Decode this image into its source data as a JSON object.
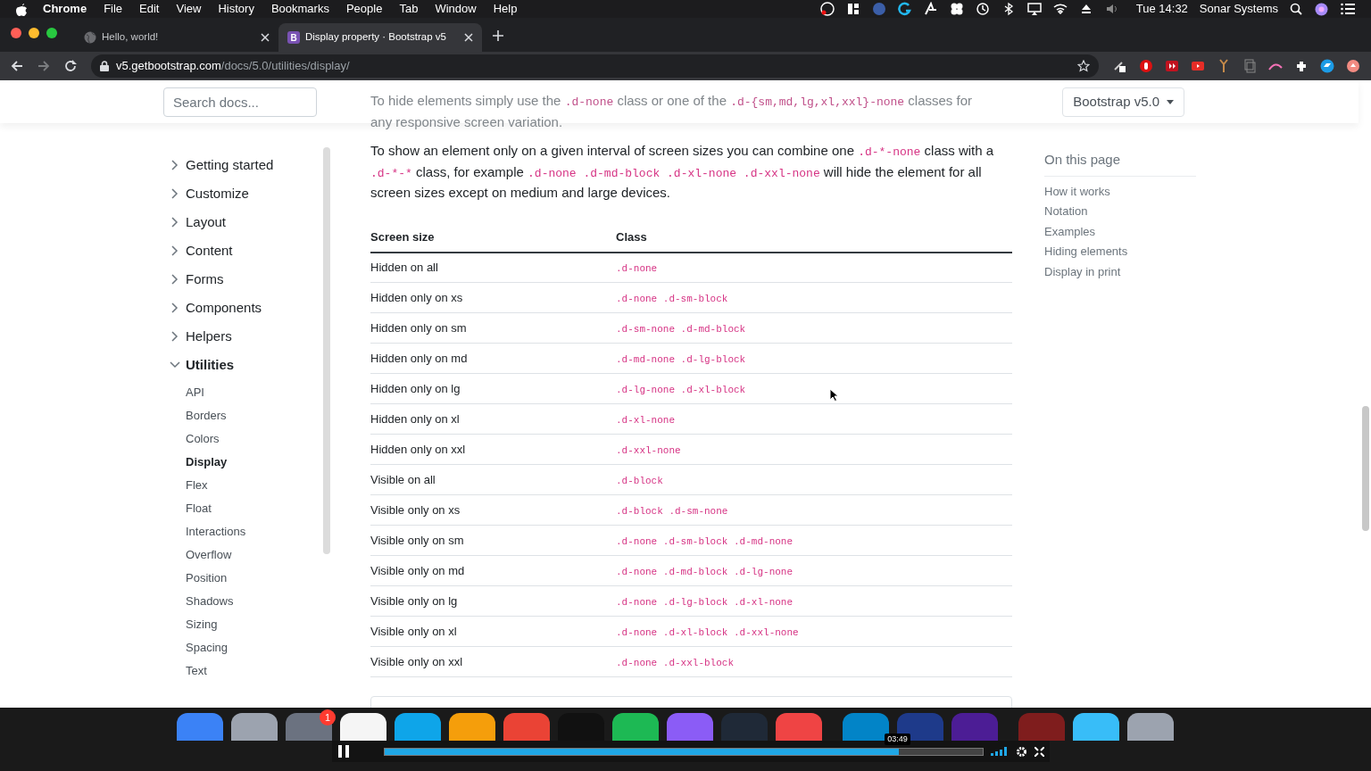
{
  "menubar": {
    "app": "Chrome",
    "menus": [
      "File",
      "Edit",
      "View",
      "History",
      "Bookmarks",
      "People",
      "Tab",
      "Window",
      "Help"
    ],
    "clock": "Tue 14:32",
    "user": "Sonar Systems"
  },
  "tabs": [
    {
      "title": "Hello, world!",
      "selected": false
    },
    {
      "title": "Display property · Bootstrap v5",
      "selected": true,
      "favicon_letter": "B"
    }
  ],
  "address": {
    "host": "v5.getbootstrap.com",
    "path": "/docs/5.0/utilities/display/"
  },
  "header": {
    "search_placeholder": "Search docs...",
    "version_button": "Bootstrap v5.0"
  },
  "faded_intro": [
    {
      "kind": "text",
      "text": "To hide elements simply use the "
    },
    {
      "kind": "code",
      "text": ".d-none"
    },
    {
      "kind": "text",
      "text": " class or one of the "
    },
    {
      "kind": "code",
      "text": ".d-{sm,md,lg,xl,xxl}-none"
    },
    {
      "kind": "text",
      "text": " classes for any responsive screen variation."
    }
  ],
  "sidebar": [
    {
      "label": "Getting started",
      "expanded": false
    },
    {
      "label": "Customize",
      "expanded": false
    },
    {
      "label": "Layout",
      "expanded": false
    },
    {
      "label": "Content",
      "expanded": false
    },
    {
      "label": "Forms",
      "expanded": false
    },
    {
      "label": "Components",
      "expanded": false
    },
    {
      "label": "Helpers",
      "expanded": false
    },
    {
      "label": "Utilities",
      "expanded": true,
      "children": [
        {
          "label": "API",
          "selected": false
        },
        {
          "label": "Borders",
          "selected": false
        },
        {
          "label": "Colors",
          "selected": false
        },
        {
          "label": "Display",
          "selected": true
        },
        {
          "label": "Flex",
          "selected": false
        },
        {
          "label": "Float",
          "selected": false
        },
        {
          "label": "Interactions",
          "selected": false
        },
        {
          "label": "Overflow",
          "selected": false
        },
        {
          "label": "Position",
          "selected": false
        },
        {
          "label": "Shadows",
          "selected": false
        },
        {
          "label": "Sizing",
          "selected": false
        },
        {
          "label": "Spacing",
          "selected": false
        },
        {
          "label": "Text",
          "selected": false
        }
      ]
    }
  ],
  "paragraph": [
    {
      "kind": "text",
      "text": "To show an element only on a given interval of screen sizes you can combine one "
    },
    {
      "kind": "code",
      "text": ".d-*-none"
    },
    {
      "kind": "text",
      "text": " class with a "
    },
    {
      "kind": "code",
      "text": ".d-*-*"
    },
    {
      "kind": "text",
      "text": " class, for example "
    },
    {
      "kind": "code",
      "text": ".d-none .d-md-block .d-xl-none .d-xxl-none"
    },
    {
      "kind": "text",
      "text": " will hide the element for all screen sizes except on medium and large devices."
    }
  ],
  "table": {
    "columns": [
      "Screen size",
      "Class"
    ],
    "rows": [
      {
        "screen_size": "Hidden on all",
        "class": ".d-none"
      },
      {
        "screen_size": "Hidden only on xs",
        "class": ".d-none .d-sm-block"
      },
      {
        "screen_size": "Hidden only on sm",
        "class": ".d-sm-none .d-md-block"
      },
      {
        "screen_size": "Hidden only on md",
        "class": ".d-md-none .d-lg-block"
      },
      {
        "screen_size": "Hidden only on lg",
        "class": ".d-lg-none .d-xl-block"
      },
      {
        "screen_size": "Hidden only on xl",
        "class": ".d-xl-none"
      },
      {
        "screen_size": "Hidden only on xxl",
        "class": ".d-xxl-none"
      },
      {
        "screen_size": "Visible on all",
        "class": ".d-block"
      },
      {
        "screen_size": "Visible only on xs",
        "class": ".d-block .d-sm-none"
      },
      {
        "screen_size": "Visible only on sm",
        "class": ".d-none .d-sm-block .d-md-none"
      },
      {
        "screen_size": "Visible only on md",
        "class": ".d-none .d-md-block .d-lg-none"
      },
      {
        "screen_size": "Visible only on lg",
        "class": ".d-none .d-lg-block .d-xl-none"
      },
      {
        "screen_size": "Visible only on xl",
        "class": ".d-none .d-xl-block .d-xxl-none"
      },
      {
        "screen_size": "Visible only on xxl",
        "class": ".d-none .d-xxl-block"
      }
    ]
  },
  "toc": {
    "title": "On this page",
    "items": [
      "How it works",
      "Notation",
      "Examples",
      "Hiding elements",
      "Display in print"
    ]
  },
  "dock": [
    {
      "color": "#3b82f6"
    },
    {
      "color": "#9ca3af"
    },
    {
      "color": "#6b7280",
      "badge": "1"
    },
    {
      "color": "#f5f5f5"
    },
    {
      "color": "#0ea5e9"
    },
    {
      "color": "#f59e0b"
    },
    {
      "color": "#ea4335"
    },
    {
      "color": "#111111"
    },
    {
      "color": "#1db954"
    },
    {
      "color": "#8b5cf6"
    },
    {
      "color": "#1f2937"
    },
    {
      "color": "#ef4444"
    },
    {
      "color": "#0284c7"
    },
    {
      "color": "#1e3a8a"
    },
    {
      "color": "#4c1d95"
    },
    {
      "color": "#7f1d1d"
    },
    {
      "color": "#38bdf8"
    },
    {
      "color": "#9ca3af"
    }
  ],
  "video": {
    "time": "03:49",
    "level": 0.86
  }
}
